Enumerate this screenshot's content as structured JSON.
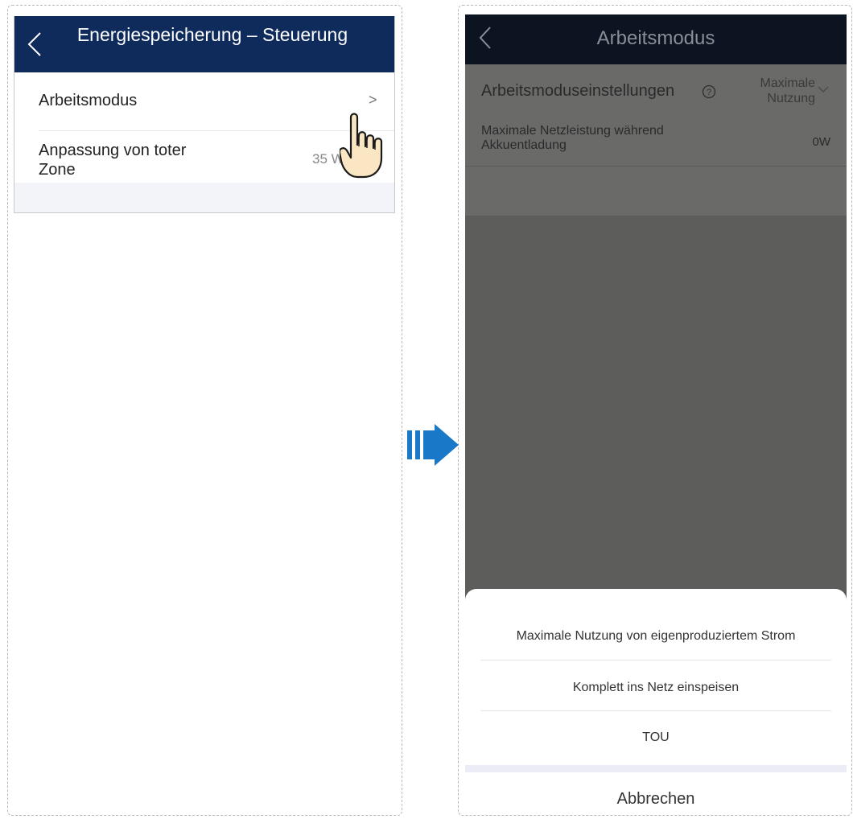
{
  "left_screen": {
    "header_title": "Energiespeicherung – Steuerung",
    "rows": [
      {
        "label": "Arbeitsmodus",
        "value": "",
        "chevron": ">"
      },
      {
        "label": "Anpassung von toter Zone",
        "value": "35 W",
        "chevron": ">"
      }
    ]
  },
  "right_screen": {
    "header_title": "Arbeitsmodus",
    "work_mode_setting": {
      "label": "Arbeitsmoduseinstellungen",
      "value_line1": "Maximale",
      "value_line2": "Nutzung"
    },
    "max_grid_power": {
      "label": "Maximale Netzleistung während Akkuentladung",
      "value": "0W"
    },
    "action_sheet": {
      "options": [
        "Maximale Nutzung von eigenproduziertem Strom",
        "Komplett ins Netz einspeisen",
        "TOU"
      ],
      "cancel_label": "Abbrechen"
    }
  },
  "colors": {
    "header_navy": "#0e2b5c",
    "arrow_blue": "#1a78c9",
    "overlay_gray": "#5d5e5c"
  },
  "icons": [
    "back-arrow-icon",
    "chevron-right-icon",
    "pointing-hand-icon",
    "help-circle-icon",
    "chevron-down-icon",
    "transition-arrow-icon"
  ]
}
